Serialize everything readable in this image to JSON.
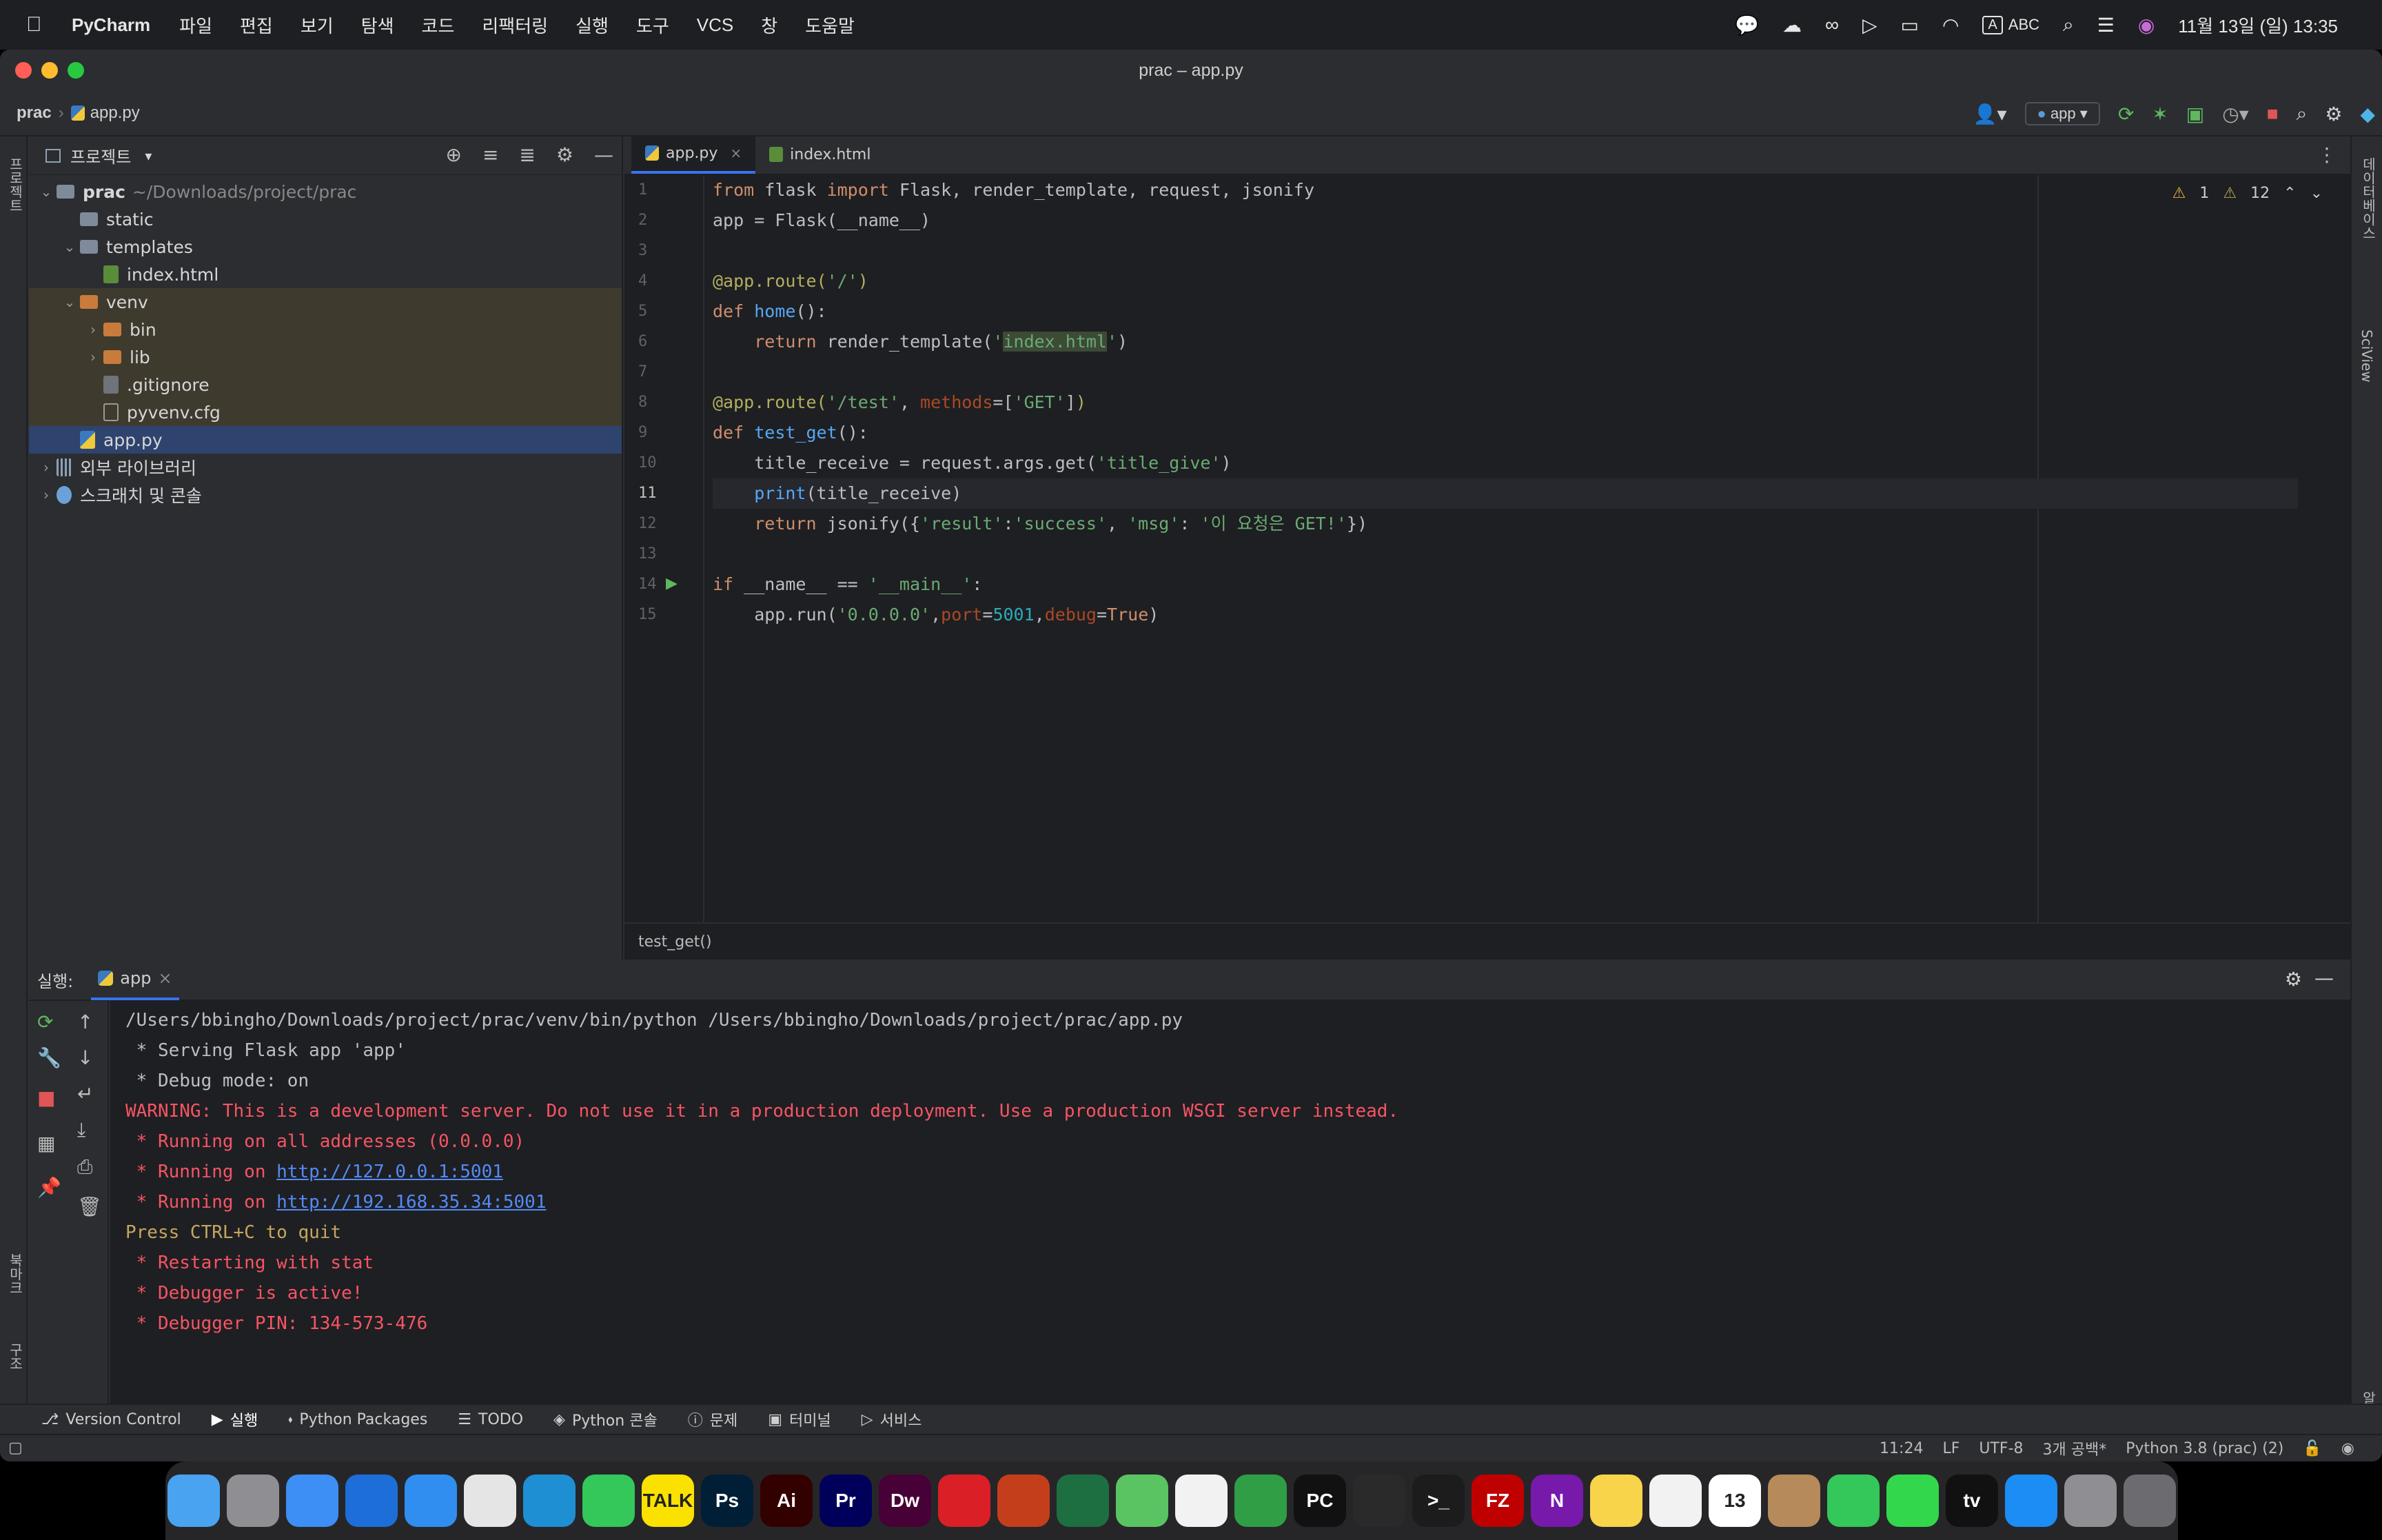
{
  "menubar": {
    "apple_glyph": "",
    "app_name": "PyCharm",
    "items": [
      "파일",
      "편집",
      "보기",
      "탐색",
      "코드",
      "리팩터링",
      "실행",
      "도구",
      "VCS",
      "창",
      "도움말"
    ],
    "input_source": "A",
    "input_label": "ABC",
    "clock": "11월 13일 (일) 13:35"
  },
  "window": {
    "title": "prac – app.py",
    "breadcrumb": [
      "prac",
      "app.py"
    ],
    "run_config": "app"
  },
  "left_strip": {
    "project_label": "프로젝트",
    "bookmarks_label": "북마크",
    "structure_label": "구조"
  },
  "right_strip": {
    "database_label": "데이터베이스",
    "sciview_label": "SciView",
    "notifications_label": "알림"
  },
  "project": {
    "header": "프로젝트",
    "tree": [
      {
        "label": "prac",
        "hint": "~/Downloads/project/prac",
        "depth": 0,
        "chevron": "v",
        "kind": "folder",
        "bold": true
      },
      {
        "label": "static",
        "depth": 1,
        "chevron": "",
        "kind": "folder"
      },
      {
        "label": "templates",
        "depth": 1,
        "chevron": "v",
        "kind": "folder"
      },
      {
        "label": "index.html",
        "depth": 2,
        "chevron": "",
        "kind": "html"
      },
      {
        "label": "venv",
        "depth": 1,
        "chevron": "v",
        "kind": "folder-orange",
        "venv": true
      },
      {
        "label": "bin",
        "depth": 2,
        "chevron": ">",
        "kind": "folder-orange",
        "venv": true
      },
      {
        "label": "lib",
        "depth": 2,
        "chevron": ">",
        "kind": "folder-orange",
        "venv": true
      },
      {
        "label": ".gitignore",
        "depth": 2,
        "chevron": "",
        "kind": "git",
        "venv": true
      },
      {
        "label": "pyvenv.cfg",
        "depth": 2,
        "chevron": "",
        "kind": "cfg",
        "venv": true
      },
      {
        "label": "app.py",
        "depth": 1,
        "chevron": "",
        "kind": "py",
        "selected": true
      },
      {
        "label": "외부 라이브러리",
        "depth": 0,
        "chevron": ">",
        "kind": "lib"
      },
      {
        "label": "스크래치 및 콘솔",
        "depth": 0,
        "chevron": ">",
        "kind": "scratch"
      }
    ]
  },
  "editor": {
    "tabs": [
      {
        "label": "app.py",
        "active": true
      },
      {
        "label": "index.html",
        "active": false
      }
    ],
    "inspection": {
      "warnings": "1",
      "weak_warnings": "12"
    },
    "current_line": 11,
    "breadcrumb_footer": "test_get()",
    "lines": [
      "1",
      "2",
      "3",
      "4",
      "5",
      "6",
      "7",
      "8",
      "9",
      "10",
      "11",
      "12",
      "13",
      "14",
      "15"
    ]
  },
  "run": {
    "header": "실행:",
    "tab": "app",
    "console": {
      "l1": "/Users/bbingho/Downloads/project/prac/venv/bin/python /Users/bbingho/Downloads/project/prac/app.py",
      "l2": " * Serving Flask app 'app'",
      "l3": " * Debug mode: on",
      "l4": "WARNING: This is a development server. Do not use it in a production deployment. Use a production WSGI server instead.",
      "l5": " * Running on all addresses (0.0.0.0)",
      "l6_prefix": " * Running on ",
      "l6_link": "http://127.0.0.1:5001",
      "l7_prefix": " * Running on ",
      "l7_link": "http://192.168.35.34:5001",
      "l8": "Press CTRL+C to quit",
      "l9": " * Restarting with stat",
      "l10": " * Debugger is active!",
      "l11": " * Debugger PIN: 134-573-476"
    }
  },
  "bottom_tools": [
    "Version Control",
    "실행",
    "Python Packages",
    "TODO",
    "Python 콘솔",
    "문제",
    "터미널",
    "서비스"
  ],
  "statusbar": {
    "position": "11:24",
    "line_sep": "LF",
    "encoding": "UTF-8",
    "indent": "3개 공백*",
    "interpreter": "Python 3.8 (prac) (2)"
  },
  "dock": [
    {
      "name": "finder-icon",
      "label": "",
      "color": "#4aa3f0"
    },
    {
      "name": "launchpad-icon",
      "label": "",
      "color": "#8e8e93"
    },
    {
      "name": "mail-icon",
      "label": "",
      "color": "#3d8ef5"
    },
    {
      "name": "onedrive-icon",
      "label": "",
      "color": "#1d6ed8"
    },
    {
      "name": "safari-icon",
      "label": "",
      "color": "#2f8ef0"
    },
    {
      "name": "chrome-icon",
      "label": "",
      "color": "#e5e5e5"
    },
    {
      "name": "edge-icon",
      "label": "",
      "color": "#1e8fd3"
    },
    {
      "name": "messages-icon",
      "label": "",
      "color": "#34c759"
    },
    {
      "name": "kakaotalk-icon",
      "label": "TALK",
      "color": "#fae100"
    },
    {
      "name": "photoshop-icon",
      "label": "Ps",
      "color": "#001e36"
    },
    {
      "name": "illustrator-icon",
      "label": "Ai",
      "color": "#330000"
    },
    {
      "name": "premiere-icon",
      "label": "Pr",
      "color": "#00005b"
    },
    {
      "name": "dreamweaver-icon",
      "label": "Dw",
      "color": "#470137"
    },
    {
      "name": "creative-cloud-icon",
      "label": "",
      "color": "#da1f26"
    },
    {
      "name": "powerpoint-icon",
      "label": "",
      "color": "#c43e1c"
    },
    {
      "name": "excel-icon",
      "label": "",
      "color": "#1d6f42"
    },
    {
      "name": "maps-icon",
      "label": "",
      "color": "#5ac462"
    },
    {
      "name": "photos-icon",
      "label": "",
      "color": "#f2f2f2"
    },
    {
      "name": "leaf-icon",
      "label": "",
      "color": "#2f9e44"
    },
    {
      "name": "pycharm-icon",
      "label": "PC",
      "color": "#111111"
    },
    {
      "name": "bear-icon",
      "label": "",
      "color": "#2a2a2a"
    },
    {
      "name": "terminal-icon",
      "label": ">_",
      "color": "#1c1c1c"
    },
    {
      "name": "filezilla-icon",
      "label": "FZ",
      "color": "#bf0000"
    },
    {
      "name": "onenote-icon",
      "label": "N",
      "color": "#7719aa"
    },
    {
      "name": "notes-icon",
      "label": "",
      "color": "#f7d44a"
    },
    {
      "name": "reminders-icon",
      "label": "",
      "color": "#f2f2f2"
    },
    {
      "name": "calendar-icon",
      "label": "13",
      "color": "#ffffff"
    },
    {
      "name": "contacts-icon",
      "label": "",
      "color": "#b68a5a"
    },
    {
      "name": "facetime-icon",
      "label": "",
      "color": "#34c759"
    },
    {
      "name": "find-my-icon",
      "label": "",
      "color": "#32d74b"
    },
    {
      "name": "appletv-icon",
      "label": "tv",
      "color": "#111111"
    },
    {
      "name": "app-store-icon",
      "label": "",
      "color": "#1b8df5"
    },
    {
      "name": "system-settings-icon",
      "label": "",
      "color": "#8e8e93"
    },
    {
      "name": "trash-icon",
      "label": "",
      "color": "#6c6c70"
    }
  ]
}
